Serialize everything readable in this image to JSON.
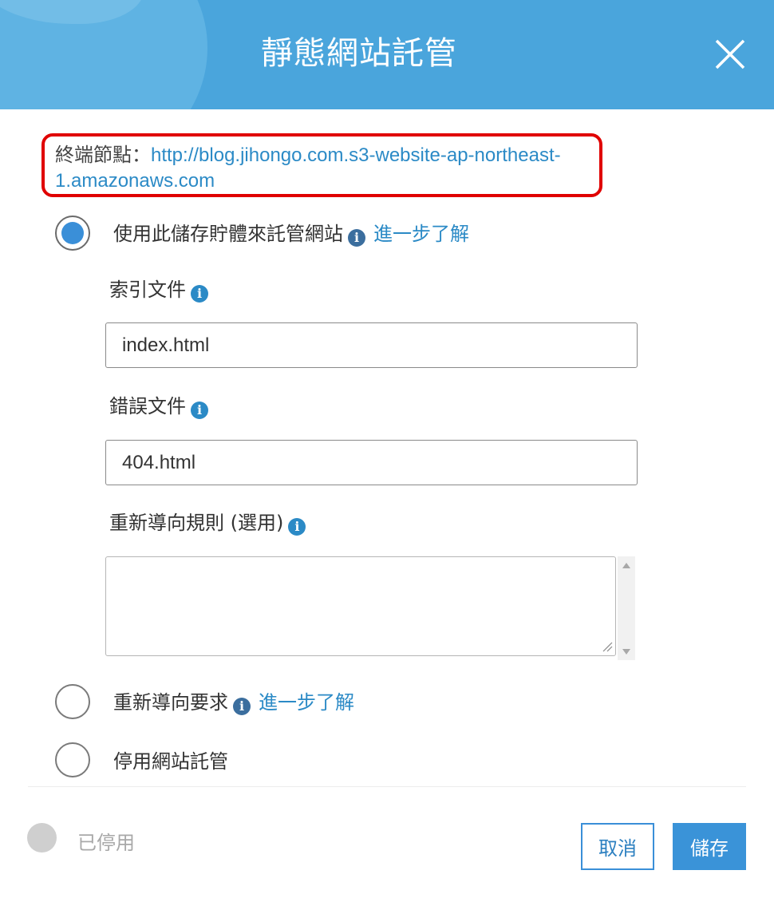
{
  "header": {
    "title": "靜態網站託管",
    "close_icon": "close-icon"
  },
  "endpoint": {
    "label": "終端節點：",
    "url": "http://blog.jihongo.com.s3-website-ap-northeast-1.amazonaws.com"
  },
  "options": {
    "use_bucket": {
      "label": "使用此儲存貯體來託管網站",
      "learn_more": "進一步了解",
      "selected": true
    },
    "redirect": {
      "label": "重新導向要求",
      "learn_more": "進一步了解",
      "selected": false
    },
    "disable": {
      "label": "停用網站託管",
      "selected": false
    }
  },
  "fields": {
    "index_document": {
      "label": "索引文件",
      "value": "index.html"
    },
    "error_document": {
      "label": "錯誤文件",
      "value": "404.html"
    },
    "redirect_rules": {
      "label": "重新導向規則 (選用)",
      "value": ""
    }
  },
  "footer": {
    "status": "已停用",
    "cancel_label": "取消",
    "save_label": "儲存"
  },
  "colors": {
    "header_bg": "#4aa5dc",
    "accent": "#3a8fd8",
    "link": "#2b8ac6",
    "highlight_border": "#e00000"
  }
}
